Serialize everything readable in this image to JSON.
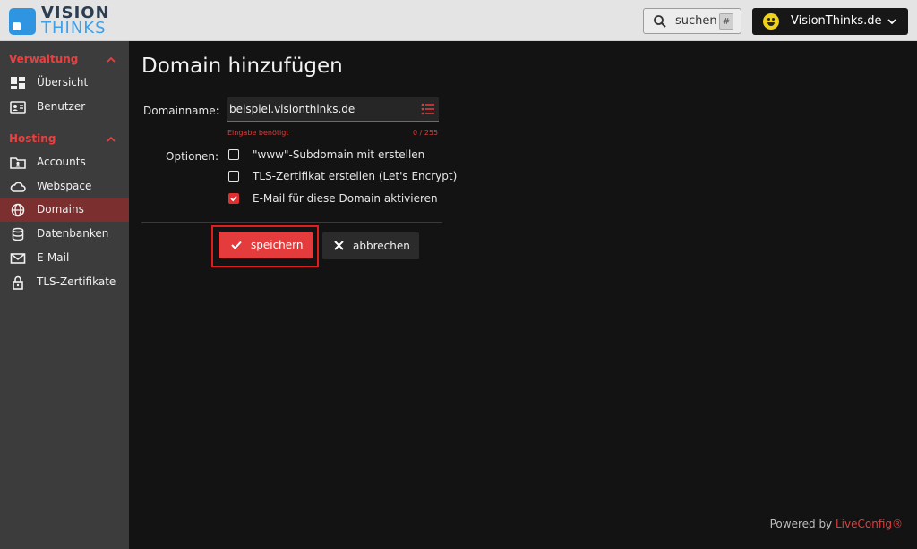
{
  "brand": {
    "line1": "VISION",
    "line2": "THINKS"
  },
  "topbar": {
    "search_label": "suchen",
    "search_shortcut": "#",
    "user_name": "VisionThinks.de"
  },
  "sidebar": {
    "sections": [
      {
        "title": "Verwaltung",
        "items": [
          {
            "label": "Übersicht",
            "icon": "dashboard-icon"
          },
          {
            "label": "Benutzer",
            "icon": "user-card-icon"
          }
        ]
      },
      {
        "title": "Hosting",
        "items": [
          {
            "label": "Accounts",
            "icon": "folder-user-icon"
          },
          {
            "label": "Webspace",
            "icon": "cloud-icon"
          },
          {
            "label": "Domains",
            "icon": "globe-icon",
            "active": true
          },
          {
            "label": "Datenbanken",
            "icon": "database-icon"
          },
          {
            "label": "E-Mail",
            "icon": "mail-icon"
          },
          {
            "label": "TLS-Zertifikate",
            "icon": "lock-icon"
          }
        ]
      }
    ]
  },
  "main": {
    "title": "Domain hinzufügen",
    "domain_label": "Domainname:",
    "domain_value": "beispiel.visionthinks.de",
    "error_text": "Eingabe benötigt",
    "char_count": "0 / 255",
    "options_label": "Optionen:",
    "options": [
      {
        "label": "\"www\"-Subdomain mit erstellen",
        "checked": false
      },
      {
        "label": "TLS-Zertifikat erstellen (Let's Encrypt)",
        "checked": false
      },
      {
        "label": "E-Mail für diese Domain aktivieren",
        "checked": true
      }
    ],
    "save_label": "speichern",
    "cancel_label": "abbrechen"
  },
  "footer": {
    "powered_prefix": "Powered by ",
    "powered_brand": "LiveConfig®"
  },
  "colors": {
    "accent": "#e43c3c",
    "brand_blue": "#2f95e0",
    "sidebar_bg": "#3c3c3c",
    "main_bg": "#131313"
  }
}
